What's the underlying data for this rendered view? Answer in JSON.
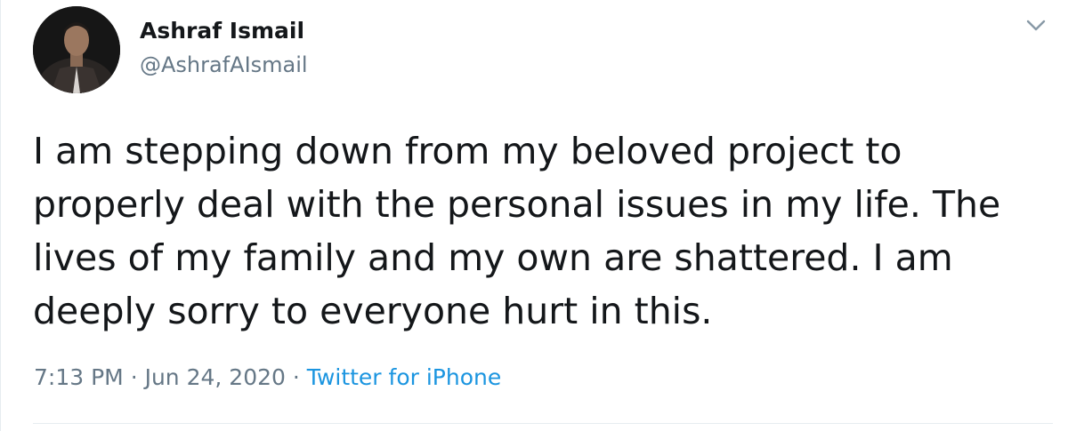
{
  "author": {
    "display_name": "Ashraf Ismail",
    "handle": "@AshrafAIsmail",
    "avatar_icon": "profile-photo"
  },
  "tweet": {
    "lines": [
      "I am stepping down from my beloved project to",
      "properly deal with the personal issues in my life. The",
      "lives of my family and my own are shattered. I am",
      "deeply sorry to everyone hurt in this."
    ],
    "time": "7:13 PM",
    "separator": "·",
    "date": "Jun 24, 2020",
    "source": "Twitter for iPhone"
  },
  "icons": {
    "menu": "chevron-down-icon"
  },
  "colors": {
    "text": "#14171a",
    "secondary": "#657786",
    "link": "#1b95e0",
    "divider": "#e6ecf0"
  }
}
